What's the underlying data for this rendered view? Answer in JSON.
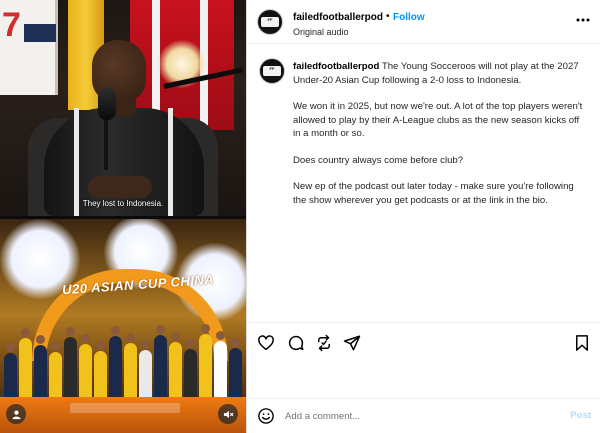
{
  "post": {
    "username": "failedfootballerpod",
    "separator": "•",
    "follow_label": "Follow",
    "audio": "Original audio",
    "more_icon": "more-horizontal-icon"
  },
  "media": {
    "video_caption": "They lost to Indonesia.",
    "banner_text": "U20 ASIAN CUP CHINA",
    "user_icon": "user-tag-icon",
    "mute_icon": "muted-speaker-icon"
  },
  "caption": {
    "username": "failedfootballerpod",
    "paragraphs": [
      "The Young Socceroos will not play at the 2027 Under-20 Asian Cup following a 2-0 loss to Indonesia.",
      "We won it in 2025, but now we're out. A lot of the top players weren't allowed to play by their A-League clubs as the new season kicks off in a month or so.",
      "Does country always come before club?",
      "New ep of the podcast out later today - make sure you're following the show wherever you get podcasts or at the link in the bio."
    ]
  },
  "actions": {
    "like_icon": "heart-icon",
    "comment_icon": "comment-icon",
    "repost_icon": "repost-icon",
    "share_icon": "send-icon",
    "save_icon": "bookmark-icon"
  },
  "comment_box": {
    "emoji_icon": "emoji-icon",
    "placeholder": "Add a comment...",
    "post_label": "Post"
  },
  "colors": {
    "follow_blue": "#0095f6",
    "post_disabled": "#b3dbff"
  }
}
